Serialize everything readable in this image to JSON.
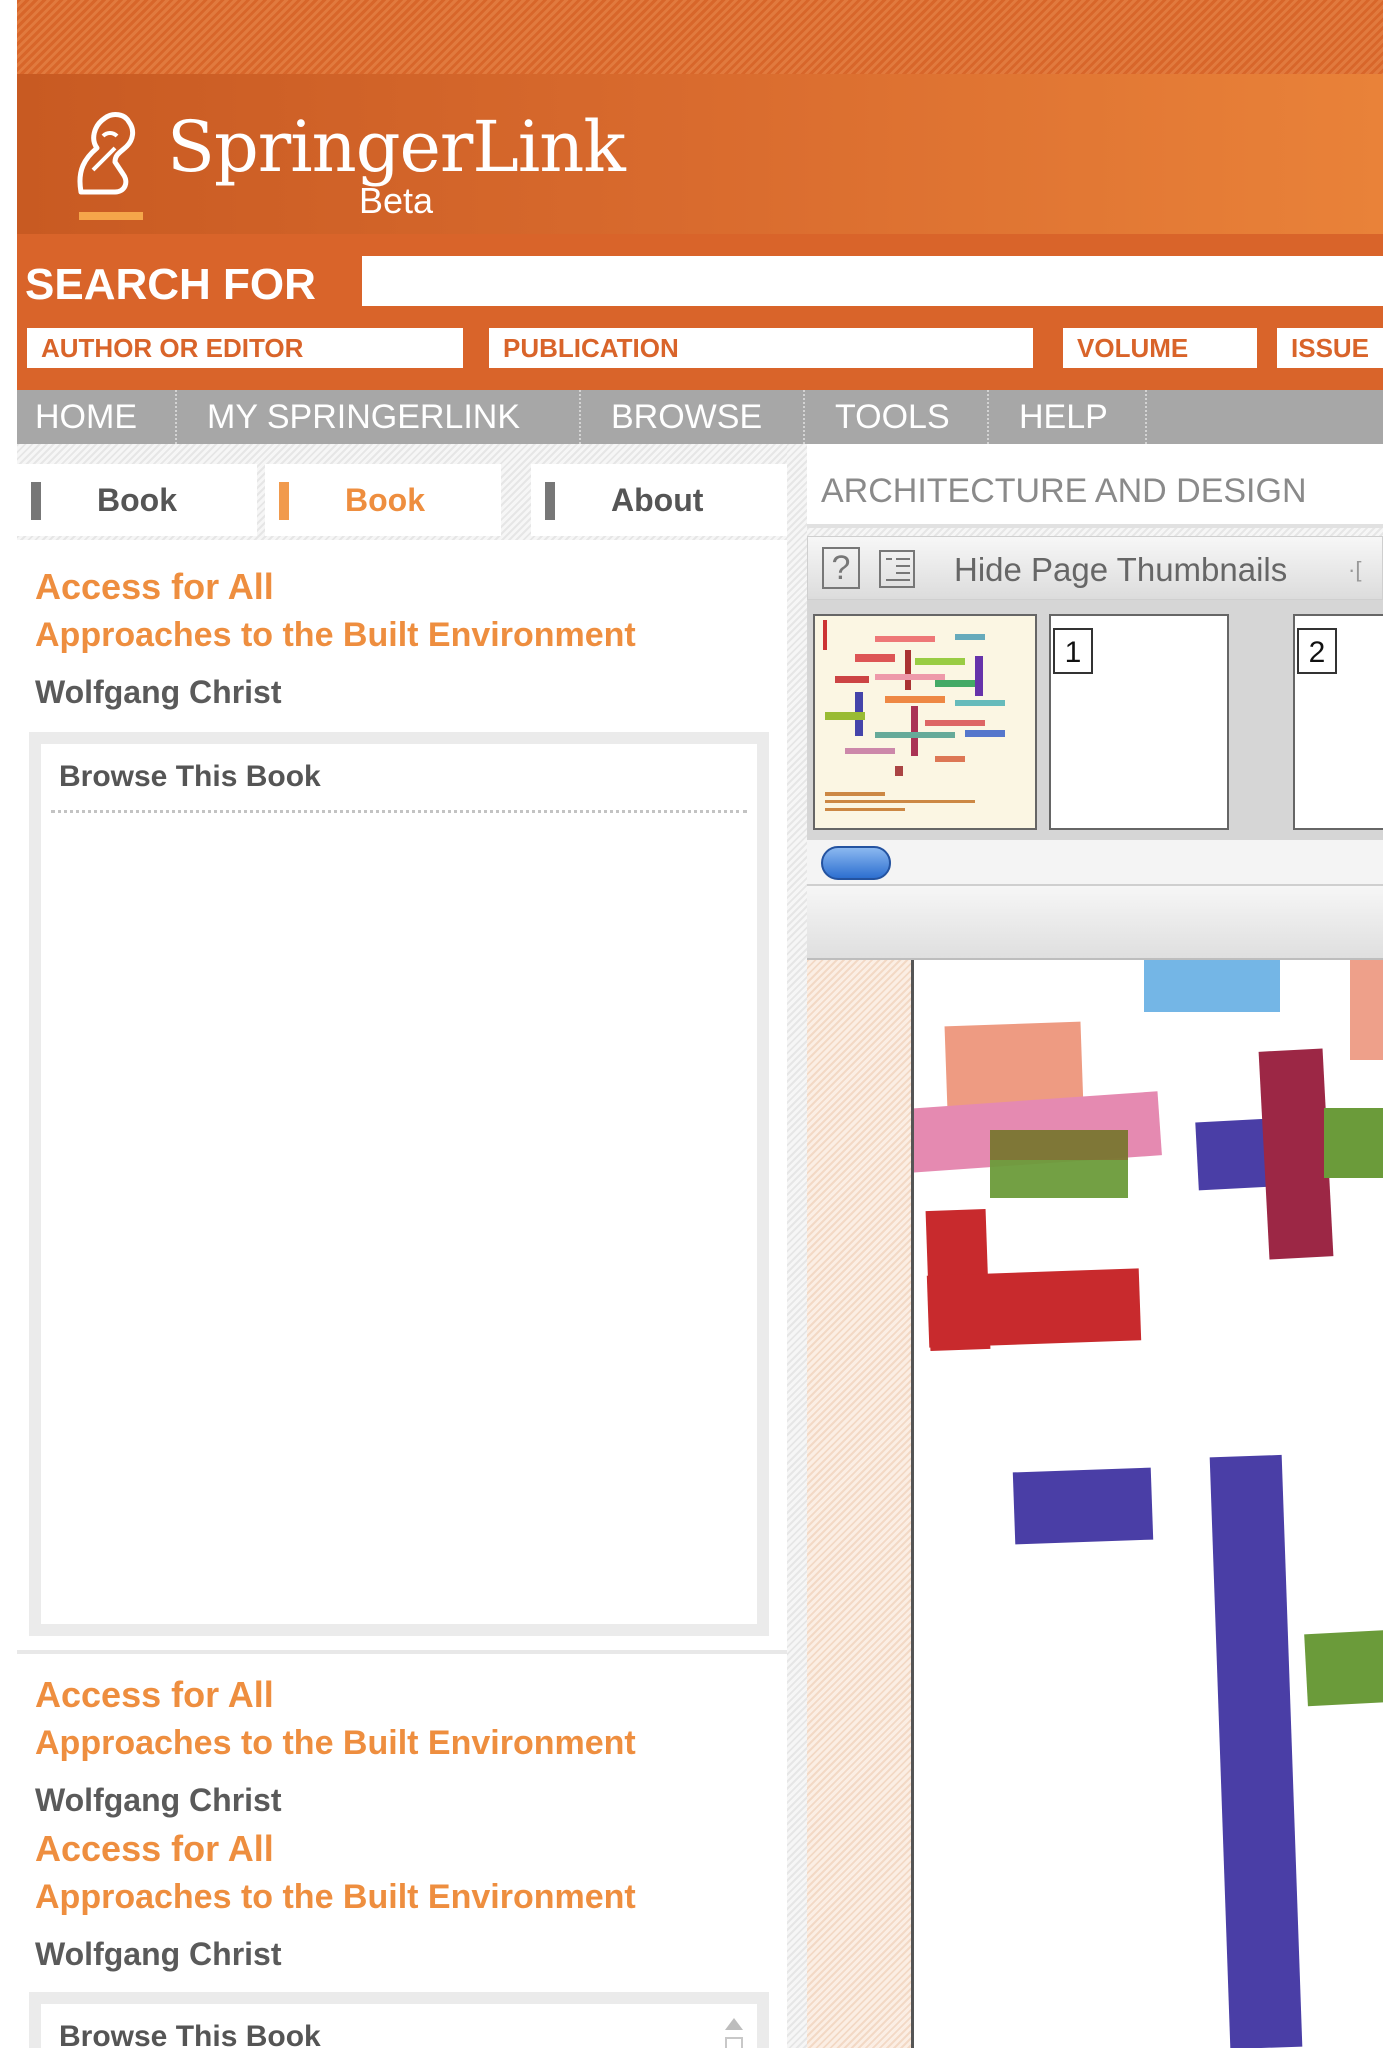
{
  "brand": {
    "name": "SpringerLink",
    "badge": "Beta"
  },
  "search": {
    "label": "SEARCH FOR",
    "value": "",
    "fields": [
      "AUTHOR OR EDITOR",
      "PUBLICATION",
      "VOLUME",
      "ISSUE"
    ]
  },
  "nav": {
    "items": [
      "HOME",
      "MY SPRINGERLINK",
      "BROWSE",
      "TOOLS",
      "HELP"
    ]
  },
  "left": {
    "tabs": [
      {
        "label": "Book",
        "active": false
      },
      {
        "label": "Book",
        "active": true
      },
      {
        "label": "About",
        "active": false
      }
    ],
    "book": {
      "title": "Access for All",
      "subtitle": "Approaches to the Built Environment",
      "author": "Wolfgang Christ"
    },
    "browse_title": "Browse This Book"
  },
  "right": {
    "category": "ARCHITECTURE AND DESIGN",
    "toolbar": {
      "help_glyph": "?",
      "thumbnails_label": "Hide Page Thumbnails",
      "more_glyph": "·["
    },
    "thumbnails": [
      {
        "number": ""
      },
      {
        "number": "1"
      },
      {
        "number": "2"
      }
    ]
  },
  "colors": {
    "accent": "#d9642a",
    "title_orange": "#ee8e3f",
    "nav_gray": "#a7a7a7"
  },
  "icons": [
    "springer-horse-logo-icon",
    "help-icon",
    "page-list-icon",
    "scroll-up-arrow-icon"
  ]
}
